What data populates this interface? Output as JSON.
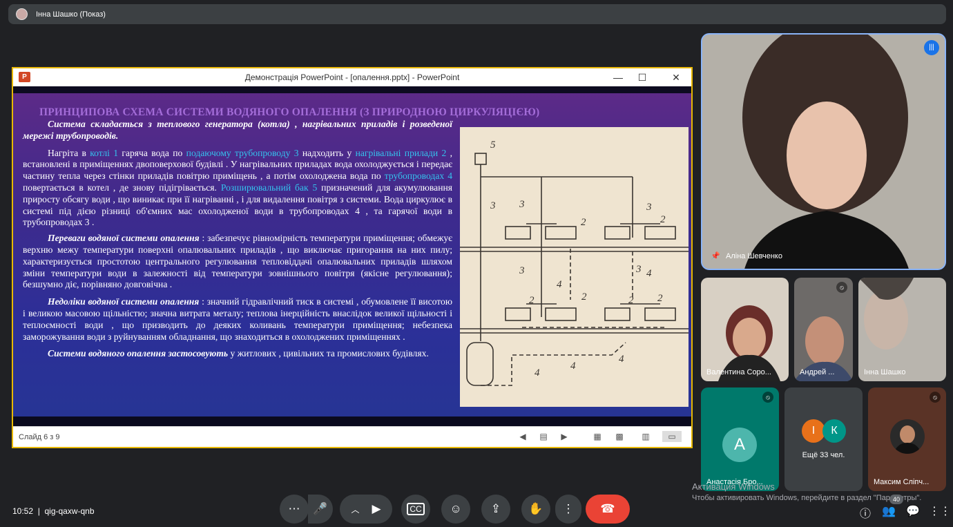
{
  "meet": {
    "presenter_bar": "Інна Шашко (Показ)",
    "time": "10:52",
    "meeting_code": "qig-qaxw-qnb",
    "controls": [
      "more-options",
      "microphone",
      "camera-options",
      "camera",
      "captions",
      "emoji",
      "present",
      "raise-hand",
      "more-actions",
      "leave-call"
    ],
    "right_controls": [
      "info",
      "people",
      "chat",
      "activities"
    ],
    "people_count": "40"
  },
  "window": {
    "title": "Демонстрація PowerPoint - [опалення.pptx] - PowerPoint",
    "app_icon": "P",
    "minimize": "—",
    "maximize": "☐",
    "close": "✕",
    "status": "Слайд 6 з 9"
  },
  "slide": {
    "title": "ПРИНЦИПОВА СХЕМА СИСТЕМИ ВОДЯНОГО ОПАЛЕННЯ (З  ПРИРОДНОЮ ЦИРКУЛЯЦІЄЮ)",
    "p1": "Система складається з теплового генератора (котла) , нагрівальних приладів і розведеної мережі трубопроводів.",
    "p2_a": "Нагріта в ",
    "p2_h1": "котлі 1",
    "p2_b": " гаряча вода по ",
    "p2_h2": "подаючому трубопроводу 3",
    "p2_c": " надходить у ",
    "p2_h3": "нагрівальні прилади 2",
    "p2_d": " , встановлені в приміщеннях двоповерхової будівлі . У нагрівальних приладах вода охолоджується і передає частину тепла через стінки приладів повітрю приміщень , а потім охолоджена вода по ",
    "p2_h4": "трубопроводах 4",
    "p2_e": " повертається в котел , де знову підігрівається. ",
    "p2_h5": "Розширювальний бак 5",
    "p2_f": " призначений для акумулювання приросту обсягу води , що виникає при її нагріванні , і для видалення повітря з системи. Вода циркулює в системі під дією різниці об'ємних мас охолодженої води в трубопроводах 4 , та гарячої води в трубопроводах 3 .",
    "p3_b": "Переваги водяної системи опалення",
    "p3": " : забезпечує рівномірність температури приміщення; обмежує верхню межу температури поверхні опалювальних приладів , що виключає пригорання на них пилу; характеризується простотою центрального регулювання тепловіддачі опалювальних приладів шляхом зміни температури води в залежності від температури зовнішнього повітря (якісне регулювання); безшумно діє, порівняно довговічна .",
    "p4_b": "Недоліки водяної системи опалення",
    "p4": " : значний гідравлічний тиск в системі , обумовлене її висотою і великою масовою щільністю; значна витрата металу; теплова інерційність внаслідок великої щільності і теплоємності води , що призводить до деяких коливань температури приміщення; небезпека заморожування води з руйнуванням обладнання, що знаходиться в охолоджених приміщеннях .",
    "p5_b": "Системи водяного опалення застосовують",
    "p5": " у житлових , цивільних та промислових будівлях.",
    "diagram_labels": [
      "5",
      "3",
      "3",
      "3",
      "2",
      "2",
      "2",
      "2",
      "3",
      "4",
      "4",
      "3",
      "4",
      "2",
      "2",
      "4",
      "4"
    ]
  },
  "participants": {
    "self": "Аліна Шевченко",
    "tiles": [
      "Валентина Соро...",
      "Андрей ...",
      "Інна Шашко",
      "Анастасія Бро...",
      "Ещё 33 чел.",
      "Максим Сліпч..."
    ],
    "avatar_letters": [
      "А",
      "І",
      "К"
    ]
  },
  "activation": {
    "line1": "Активация Windows",
    "line2": "Чтобы активировать Windows, перейдите в раздел \"Параметры\"."
  }
}
